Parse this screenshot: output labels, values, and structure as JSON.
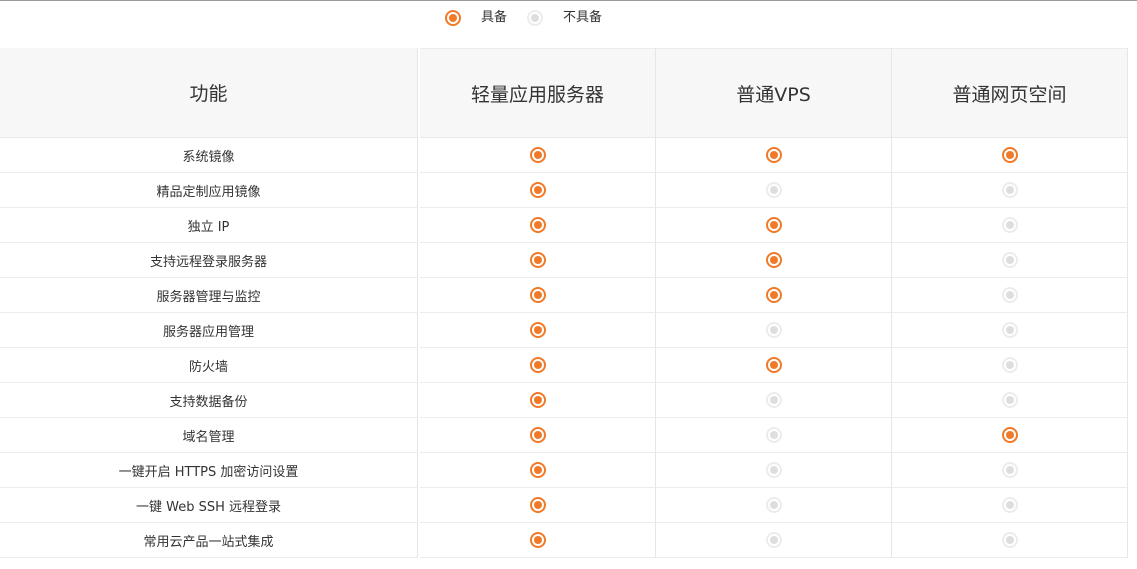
{
  "legend": {
    "available_label": "具备",
    "unavailable_label": "不具备"
  },
  "table": {
    "headers": {
      "feature": "功能",
      "col1": "轻量应用服务器",
      "col2": "普通VPS",
      "col3": "普通网页空间"
    },
    "rows": [
      {
        "feature": "系统镜像",
        "values": [
          true,
          true,
          true
        ]
      },
      {
        "feature": "精品定制应用镜像",
        "values": [
          true,
          false,
          false
        ]
      },
      {
        "feature": "独立 IP",
        "values": [
          true,
          true,
          false
        ]
      },
      {
        "feature": "支持远程登录服务器",
        "values": [
          true,
          true,
          false
        ]
      },
      {
        "feature": "服务器管理与监控",
        "values": [
          true,
          true,
          false
        ]
      },
      {
        "feature": "服务器应用管理",
        "values": [
          true,
          false,
          false
        ]
      },
      {
        "feature": "防火墙",
        "values": [
          true,
          true,
          false
        ]
      },
      {
        "feature": "支持数据备份",
        "values": [
          true,
          false,
          false
        ]
      },
      {
        "feature": "域名管理",
        "values": [
          true,
          false,
          true
        ]
      },
      {
        "feature": "一键开启 HTTPS 加密访问设置",
        "values": [
          true,
          false,
          false
        ]
      },
      {
        "feature": "一键 Web SSH 远程登录",
        "values": [
          true,
          false,
          false
        ]
      },
      {
        "feature": "常用云产品一站式集成",
        "values": [
          true,
          false,
          false
        ]
      }
    ]
  },
  "colors": {
    "available": "#f07a28",
    "unavailable": "#dedede",
    "header_bg": "#f7f7f7"
  },
  "icons": {
    "available": "radio-checked-icon",
    "unavailable": "radio-unchecked-icon"
  }
}
